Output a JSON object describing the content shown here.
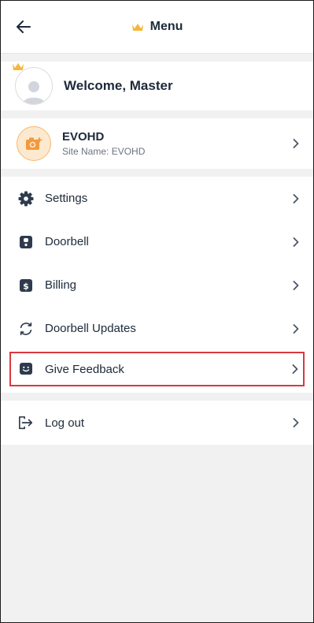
{
  "header": {
    "title": "Menu",
    "back_icon": "arrow-left-icon",
    "crown_color": "#f5b73b"
  },
  "welcome": {
    "text": "Welcome, Master"
  },
  "site": {
    "name": "EVOHD",
    "subtitle": "Site Name: EVOHD",
    "icon": "camera-icon"
  },
  "menu": {
    "items": [
      {
        "label": "Settings",
        "icon": "gear-icon"
      },
      {
        "label": "Doorbell",
        "icon": "doorbell-icon"
      },
      {
        "label": "Billing",
        "icon": "dollar-icon"
      },
      {
        "label": "Doorbell Updates",
        "icon": "refresh-icon"
      },
      {
        "label": "Give Feedback",
        "icon": "feedback-icon",
        "highlighted": true
      }
    ]
  },
  "logout": {
    "label": "Log out",
    "icon": "logout-icon"
  },
  "colors": {
    "accent": "#f5b73b",
    "text": "#1d2a3a",
    "highlight_border": "#d9393f",
    "background": "#f1f1f2"
  }
}
